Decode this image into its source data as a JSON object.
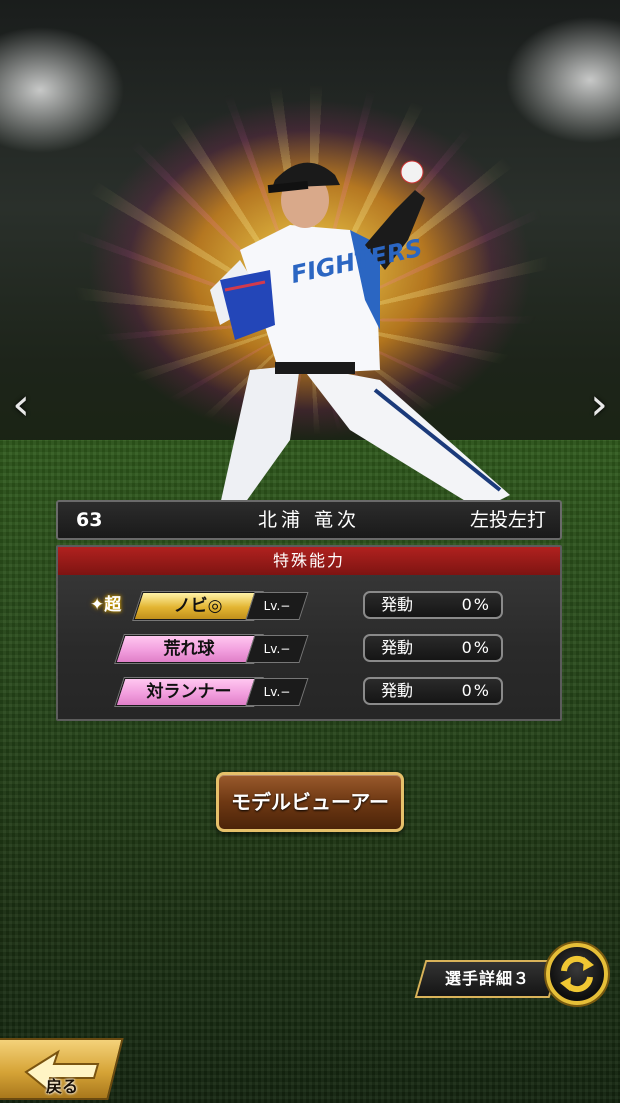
{
  "navigation": {
    "prev_arrow": "‹",
    "next_arrow": "›"
  },
  "player": {
    "number": "63",
    "name": "北浦 竜次",
    "handedness": "左投左打",
    "uniform_text": "FIGHTERS"
  },
  "abilities": {
    "header": "特殊能力",
    "super_prefix": "✦超",
    "trigger_label": "発動",
    "items": [
      {
        "name": "ノビ◎",
        "level": "Lv.−",
        "rate": "0%",
        "color": "#e3b532",
        "is_super": true
      },
      {
        "name": "荒れ球",
        "level": "Lv.−",
        "rate": "0%",
        "color": "#f29fde",
        "is_super": false
      },
      {
        "name": "対ランナー",
        "level": "Lv.−",
        "rate": "0%",
        "color": "#f29fde",
        "is_super": false
      }
    ]
  },
  "buttons": {
    "model_viewer": "モデルビューアー",
    "player_detail": "選手詳細３",
    "back": "戻る"
  },
  "icons": {
    "swap": "swap-arrows-icon",
    "back": "back-arrow-icon"
  }
}
